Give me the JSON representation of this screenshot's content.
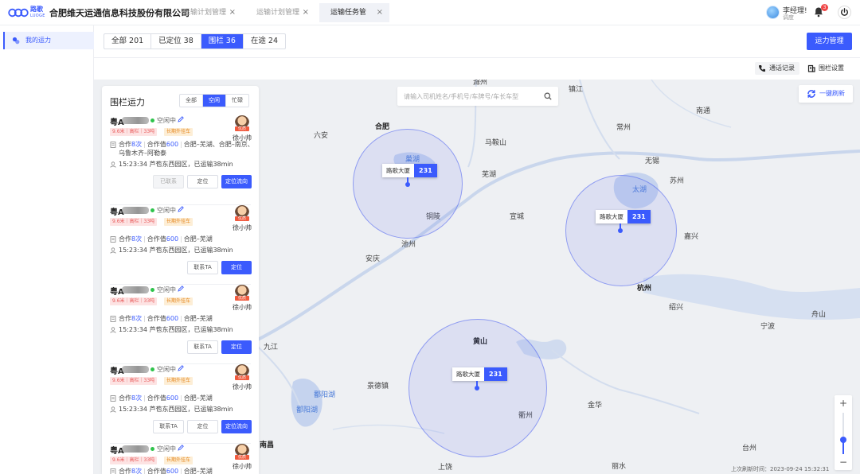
{
  "app": {
    "logo_text": "路歌",
    "logo_sub": "LUOGE",
    "company": "合肥维天运通信息科技股份有限公司"
  },
  "tabs": [
    {
      "label": "运输计划管理",
      "close": "×"
    },
    {
      "label": "运输计划管理",
      "close": "×"
    },
    {
      "label": "运输任务管",
      "close": "×"
    }
  ],
  "user": {
    "name": "李经理!",
    "role": "调度",
    "notifications": "3"
  },
  "sidebar": {
    "items": [
      {
        "label": "我的运力"
      }
    ]
  },
  "filters": [
    {
      "label": "全部 201"
    },
    {
      "label": "已定位 38"
    },
    {
      "label": "围栏 36"
    },
    {
      "label": "在途 24"
    }
  ],
  "header": {
    "capacity_button": "运力管理",
    "call_log": "通话记录",
    "fence_settings": "围栏设置"
  },
  "map": {
    "search_placeholder": "请输入司机姓名/手机号/车牌号/车长车型",
    "refresh_button": "一键刷新",
    "last_refresh": "上次刷新时间：2023-09-24 15:32:31",
    "zoom_level": 0.35,
    "cities": [
      {
        "name": "滁州"
      },
      {
        "name": "镇江"
      },
      {
        "name": "六安"
      },
      {
        "name": "合肥"
      },
      {
        "name": "巢湖"
      },
      {
        "name": "常州"
      },
      {
        "name": "南通"
      },
      {
        "name": "马鞍山"
      },
      {
        "name": "无锡"
      },
      {
        "name": "芜湖"
      },
      {
        "name": "苏州"
      },
      {
        "name": "太湖"
      },
      {
        "name": "铜陵"
      },
      {
        "name": "宣城"
      },
      {
        "name": "嘉兴"
      },
      {
        "name": "池州"
      },
      {
        "name": "安庆"
      },
      {
        "name": "杭州"
      },
      {
        "name": "绍兴"
      },
      {
        "name": "宁波"
      },
      {
        "name": "舟山"
      },
      {
        "name": "九江"
      },
      {
        "name": "黄山"
      },
      {
        "name": "景德镇"
      },
      {
        "name": "鄱阳湖"
      },
      {
        "name": "鄱阳湖"
      },
      {
        "name": "衢州"
      },
      {
        "name": "金华"
      },
      {
        "name": "台州"
      },
      {
        "name": "丽水"
      },
      {
        "name": "上饶"
      },
      {
        "name": "南昌"
      }
    ],
    "fences": [
      {
        "name": "路歌大厦",
        "count": "231"
      },
      {
        "name": "路歌大厦",
        "count": "231"
      },
      {
        "name": "路歌大厦",
        "count": "231"
      }
    ]
  },
  "panel": {
    "title": "围栏运力",
    "segments": [
      {
        "label": "全部"
      },
      {
        "label": "空闲"
      },
      {
        "label": "忙碌"
      }
    ],
    "status": "空闲中",
    "spec_tag": "9.6米｜高栏｜33吨",
    "long_tag": "长期外挂车",
    "driver_badge": "优质",
    "driver_name": "徐小帅",
    "coop_label": "合作",
    "coop_value_label": "合作值",
    "cards": [
      {
        "plate": "粤A",
        "coop_times": "8次",
        "coop_value": "600",
        "route": "合肥–芜湖、合肥–南京、",
        "route2": "乌鲁木齐–阿勒泰",
        "location": "15:23:34 芦苞东西园区，已运输38min",
        "buttons": [
          "已联系",
          "定位",
          "定位流向"
        ]
      },
      {
        "plate": "粤A",
        "coop_times": "8次",
        "coop_value": "600",
        "route": "合肥–芜湖",
        "route2": "",
        "location": "15:23:34 芦苞东西园区，已运输38min",
        "buttons": [
          "联系TA",
          "定位"
        ]
      },
      {
        "plate": "粤A",
        "coop_times": "8次",
        "coop_value": "600",
        "route": "合肥–芜湖",
        "route2": "",
        "location": "15:23:34 芦苞东西园区，已运输38min",
        "buttons": [
          "联系TA",
          "定位"
        ]
      },
      {
        "plate": "粤A",
        "coop_times": "8次",
        "coop_value": "600",
        "route": "合肥–芜湖",
        "route2": "",
        "location": "15:23:34 芦苞东西园区，已运输38min",
        "buttons": [
          "联系TA",
          "定位",
          "定位流向"
        ]
      },
      {
        "plate": "粤A",
        "coop_times": "8次",
        "coop_value": "600",
        "route": "合肥–芜湖",
        "route2": "",
        "location": "",
        "buttons": []
      }
    ]
  },
  "colors": {
    "primary": "#3b5bfd",
    "online": "#2ec34b",
    "danger": "#f04848"
  }
}
